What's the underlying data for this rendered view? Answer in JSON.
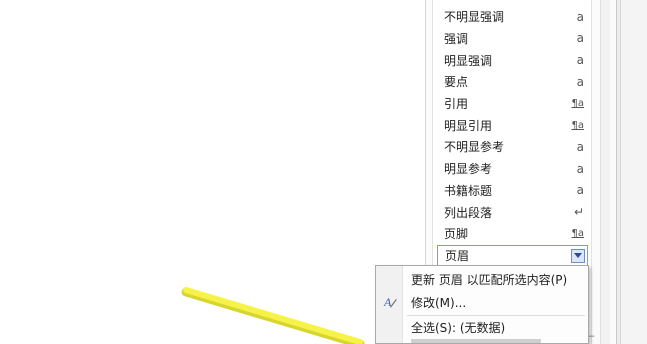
{
  "styles_pane": {
    "items": [
      {
        "label": "不明显强调",
        "glyph": "a",
        "kind": "char"
      },
      {
        "label": "强调",
        "glyph": "a",
        "kind": "char"
      },
      {
        "label": "明显强调",
        "glyph": "a",
        "kind": "char"
      },
      {
        "label": "要点",
        "glyph": "a",
        "kind": "char"
      },
      {
        "label": "引用",
        "glyph": "¶a",
        "kind": "linked"
      },
      {
        "label": "明显引用",
        "glyph": "¶a",
        "kind": "linked"
      },
      {
        "label": "不明显参考",
        "glyph": "a",
        "kind": "char"
      },
      {
        "label": "明显参考",
        "glyph": "a",
        "kind": "char"
      },
      {
        "label": "书籍标题",
        "glyph": "a",
        "kind": "char"
      },
      {
        "label": "列出段落",
        "glyph": "↵",
        "kind": "para"
      },
      {
        "label": "页脚",
        "glyph": "¶a",
        "kind": "linked"
      }
    ],
    "selected": {
      "label": "页眉",
      "icon": "dropdown-arrow-icon"
    }
  },
  "context_menu": {
    "items": [
      {
        "label": "更新 页眉 以匹配所选内容(P)",
        "icon": ""
      },
      {
        "label": "修改(M)...",
        "icon": "modify-style-icon"
      },
      {
        "label": "全选(S): (无数据)",
        "icon": ""
      }
    ]
  },
  "colors": {
    "arrow": "#f2ef3c",
    "selection_border": "#7a9fd0",
    "dropdown_fill": "#dbe7f8"
  }
}
